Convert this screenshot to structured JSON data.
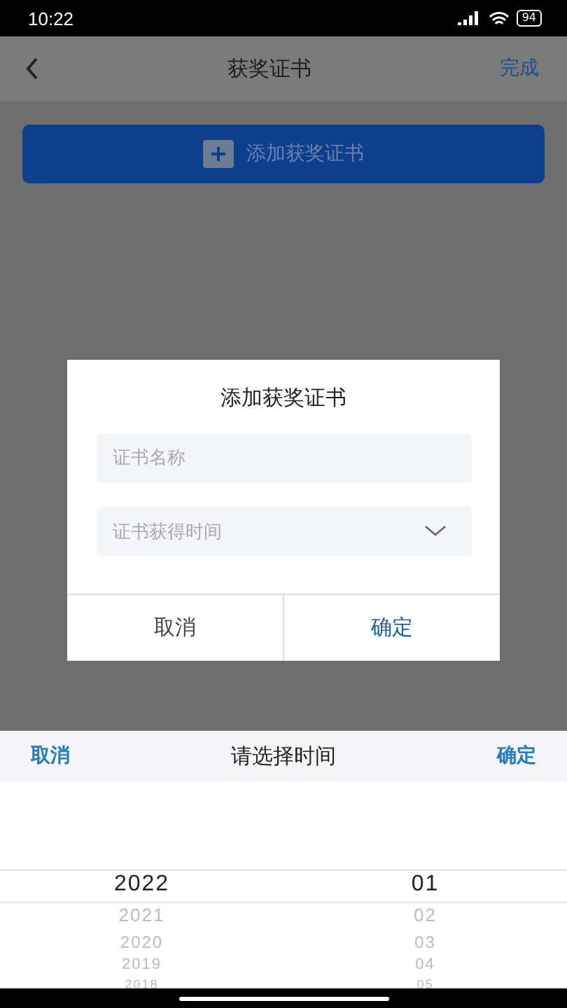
{
  "status_bar": {
    "time": "10:22",
    "battery": "94"
  },
  "header": {
    "title": "获奖证书",
    "action": "完成"
  },
  "add_button": {
    "label": "添加获奖证书"
  },
  "dialog": {
    "title": "添加获奖证书",
    "fields": [
      {
        "kind": "text",
        "placeholder": "证书名称"
      },
      {
        "kind": "select",
        "placeholder": "证书获得时间"
      }
    ],
    "buttons": [
      {
        "label": "取消",
        "primary": false
      },
      {
        "label": "确定",
        "primary": true
      }
    ]
  },
  "picker": {
    "cancel": "取消",
    "title": "请选择时间",
    "confirm": "确定",
    "columns": [
      {
        "items": [
          {
            "label": "2022",
            "selected": true
          },
          {
            "label": "2021",
            "selected": false
          },
          {
            "label": "2020",
            "selected": false
          },
          {
            "label": "2019",
            "selected": false
          },
          {
            "label": "2018",
            "selected": false
          }
        ]
      },
      {
        "items": [
          {
            "label": "01",
            "selected": true
          },
          {
            "label": "02",
            "selected": false
          },
          {
            "label": "03",
            "selected": false
          },
          {
            "label": "04",
            "selected": false
          },
          {
            "label": "05",
            "selected": false
          }
        ]
      }
    ]
  }
}
